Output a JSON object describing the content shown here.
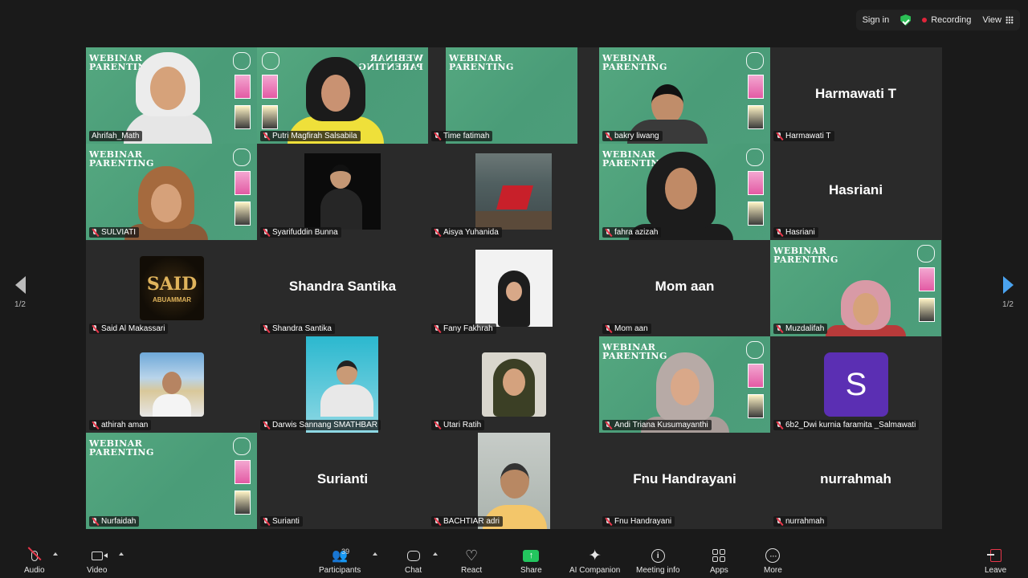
{
  "topbar": {
    "sign_in": "Sign in",
    "recording": "Recording",
    "view": "View"
  },
  "pagination": {
    "left_page": "1/2",
    "right_page": "1/2"
  },
  "participants": [
    {
      "name": "Ahrifah_Math",
      "mic_muted": false,
      "active_speaker": true,
      "kind": "webinar-video"
    },
    {
      "name": "Putri Magfirah Salsabila",
      "mic_muted": true,
      "kind": "webinar-video-mirrored"
    },
    {
      "name": "Time fatimah",
      "mic_muted": true,
      "kind": "webinar-background"
    },
    {
      "name": "bakry liwang",
      "mic_muted": true,
      "kind": "webinar-video"
    },
    {
      "name": "Harmawati T",
      "display_text": "Harmawati T",
      "mic_muted": true,
      "kind": "name-only"
    },
    {
      "name": "SULVIATI",
      "mic_muted": true,
      "kind": "webinar-video"
    },
    {
      "name": "Syarifuddin Bunna",
      "mic_muted": true,
      "kind": "photo"
    },
    {
      "name": "Aisya Yuhanida",
      "mic_muted": true,
      "kind": "photo"
    },
    {
      "name": "fahra azizah",
      "mic_muted": true,
      "kind": "webinar-video"
    },
    {
      "name": "Hasriani",
      "display_text": "Hasriani",
      "mic_muted": true,
      "kind": "name-only"
    },
    {
      "name": "Said Al Makassari",
      "mic_muted": true,
      "kind": "photo",
      "logo_text": "SAID",
      "logo_subtext": "ABUAMMAR"
    },
    {
      "name": "Shandra Santika",
      "display_text": "Shandra Santika",
      "mic_muted": true,
      "kind": "name-only"
    },
    {
      "name": "Fany Fakhrah",
      "mic_muted": true,
      "kind": "photo"
    },
    {
      "name": "Mom aan",
      "display_text": "Mom aan",
      "mic_muted": true,
      "kind": "name-only"
    },
    {
      "name": "Muzdalifah",
      "mic_muted": true,
      "kind": "webinar-video"
    },
    {
      "name": "athirah aman",
      "mic_muted": true,
      "kind": "photo"
    },
    {
      "name": "Darwis Sannang SMATHBAR",
      "mic_muted": true,
      "kind": "photo"
    },
    {
      "name": "Utari Ratih",
      "mic_muted": true,
      "kind": "photo"
    },
    {
      "name": "Andi Triana Kusumayanthi",
      "mic_muted": true,
      "kind": "webinar-video"
    },
    {
      "name": "6b2_Dwi kurnia faramita _Salmawati",
      "mic_muted": true,
      "kind": "avatar-letter",
      "letter": "S",
      "avatar_color": "#5b2fb3"
    },
    {
      "name": "Nurfaidah",
      "mic_muted": true,
      "kind": "webinar-background"
    },
    {
      "name": "Surianti",
      "display_text": "Surianti",
      "mic_muted": true,
      "kind": "name-only"
    },
    {
      "name": "BACHTIAR adri",
      "mic_muted": true,
      "kind": "photo"
    },
    {
      "name": "Fnu Handrayani",
      "display_text": "Fnu Handrayani",
      "mic_muted": true,
      "kind": "name-only"
    },
    {
      "name": "nurrahmah",
      "display_text": "nurrahmah",
      "mic_muted": true,
      "kind": "name-only"
    }
  ],
  "webinar_bg": {
    "title_line1": "WEBINAR",
    "title_line2": "PARENTING"
  },
  "toolbar": {
    "audio": "Audio",
    "video": "Video",
    "participants": "Participants",
    "participant_count": "39",
    "chat": "Chat",
    "react": "React",
    "share": "Share",
    "ai_companion": "AI Companion",
    "meeting_info": "Meeting info",
    "apps": "Apps",
    "more": "More",
    "leave": "Leave"
  },
  "colors": {
    "active_speaker_border": "#4fc56d",
    "webinar_green": "#55a880",
    "share_green": "#23c55e",
    "muted_red": "#e8364a",
    "next_arrow_blue": "#4aa3f0"
  }
}
